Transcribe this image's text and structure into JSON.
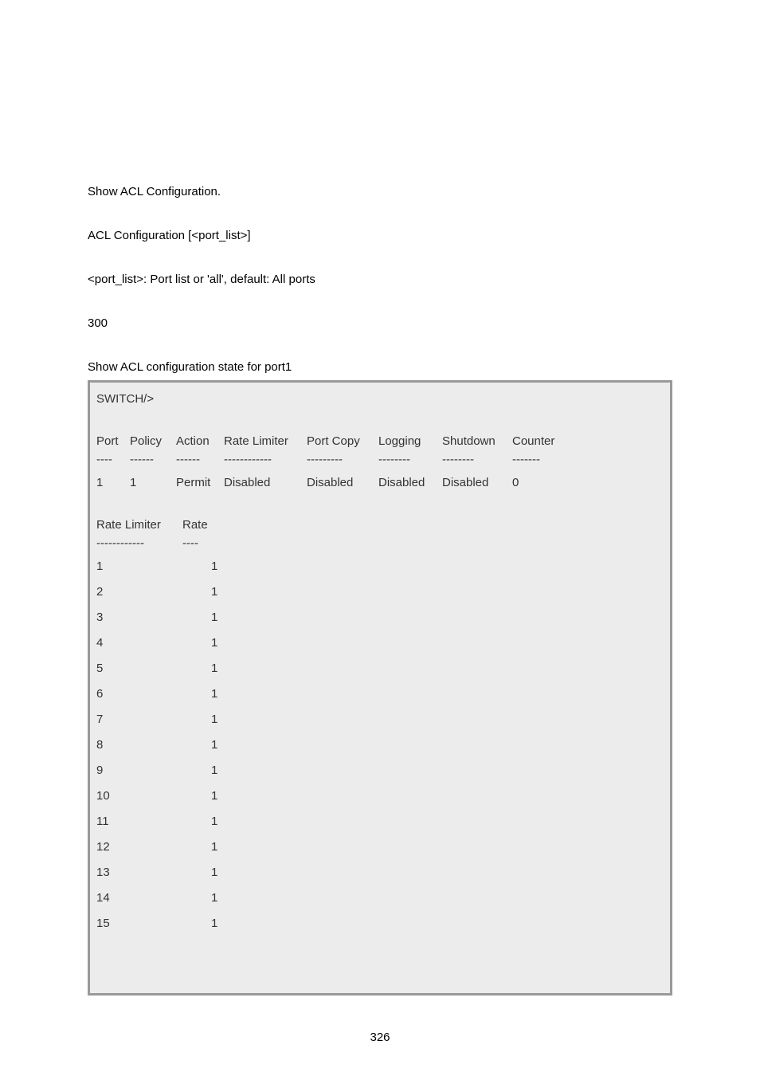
{
  "intro": {
    "line1": "Show ACL Configuration.",
    "line2": "ACL Configuration [<port_list>]",
    "line3": "<port_list>: Port list or 'all', default: All ports",
    "line4": "300",
    "line5": "Show ACL configuration state for port1"
  },
  "terminal": {
    "prompt": "SWITCH/>",
    "port_header": {
      "port": "Port",
      "policy": "Policy",
      "action": "Action",
      "rate": "Rate Limiter",
      "portcopy": "Port Copy",
      "logging": "Logging",
      "shutdown": "Shutdown",
      "counter": "Counter"
    },
    "port_divider": {
      "port": "----",
      "policy": "------",
      "action": "------",
      "rate": "------------",
      "portcopy": "---------",
      "logging": "--------",
      "shutdown": "--------",
      "counter": "-------"
    },
    "port_row": {
      "port": "1",
      "policy": "1",
      "action": "Permit",
      "rate": "Disabled",
      "portcopy": "Disabled",
      "logging": "Disabled",
      "shutdown": "Disabled",
      "counter": "0"
    },
    "rl_header": {
      "col1": "Rate Limiter",
      "col2": "Rate"
    },
    "rl_divider": {
      "col1": "------------",
      "col2": "----"
    },
    "rl_rows": [
      {
        "id": "1",
        "rate": "1"
      },
      {
        "id": "2",
        "rate": "1"
      },
      {
        "id": "3",
        "rate": "1"
      },
      {
        "id": "4",
        "rate": "1"
      },
      {
        "id": "5",
        "rate": "1"
      },
      {
        "id": "6",
        "rate": "1"
      },
      {
        "id": "7",
        "rate": "1"
      },
      {
        "id": "8",
        "rate": "1"
      },
      {
        "id": "9",
        "rate": "1"
      },
      {
        "id": "10",
        "rate": "1"
      },
      {
        "id": "11",
        "rate": "1"
      },
      {
        "id": "12",
        "rate": "1"
      },
      {
        "id": "13",
        "rate": "1"
      },
      {
        "id": "14",
        "rate": "1"
      },
      {
        "id": "15",
        "rate": "1"
      }
    ]
  },
  "page_number": "326"
}
